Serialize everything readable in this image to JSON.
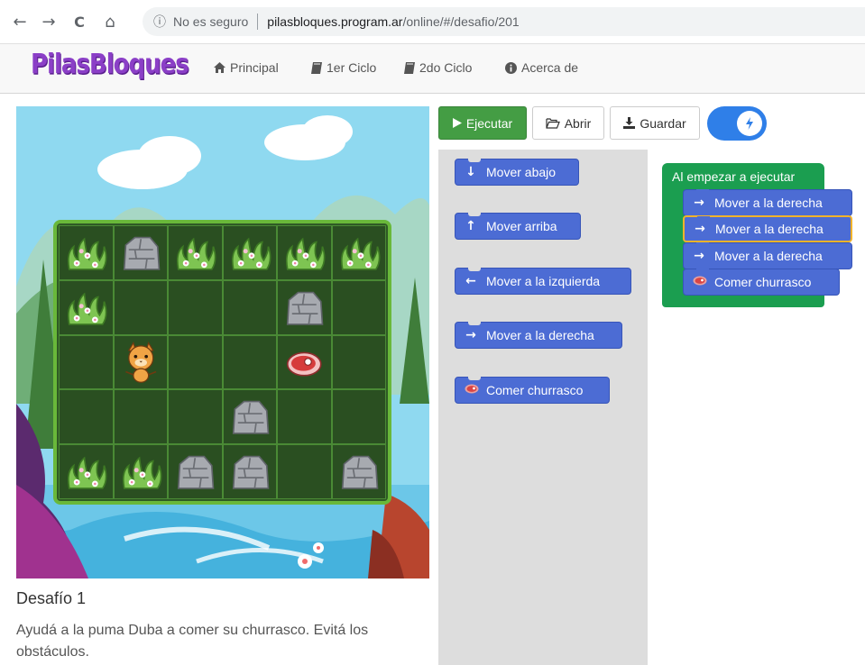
{
  "browser": {
    "back": "←",
    "forward": "→",
    "reload": "C",
    "home": "⌂",
    "info_icon": "ⓘ",
    "insecure": "No es seguro",
    "host": "pilasbloques.program.ar",
    "path": "/online/#/desafio/201"
  },
  "app": {
    "logo": "PilasBloques",
    "nav": [
      {
        "icon": "home-icon",
        "label": "Principal"
      },
      {
        "icon": "book-icon",
        "label": "1er Ciclo"
      },
      {
        "icon": "book-icon",
        "label": "2do Ciclo"
      },
      {
        "icon": "info-icon",
        "label": "Acerca de"
      }
    ]
  },
  "toolbar": {
    "run": "Ejecutar",
    "open": "Abrir",
    "save": "Guardar",
    "turbo_icon": "lightning-icon",
    "turbo_on": true
  },
  "challenge": {
    "title": "Desafío 1",
    "description": "Ayudá a la puma Duba a comer su churrasco. Evitá los obstáculos."
  },
  "toolbox": [
    {
      "icon": "arrow-down-icon",
      "label": "Mover abajo"
    },
    {
      "icon": "arrow-up-icon",
      "label": "Mover arriba"
    },
    {
      "icon": "arrow-left-icon",
      "label": "Mover a la izquierda"
    },
    {
      "icon": "arrow-right-icon",
      "label": "Mover a la derecha"
    },
    {
      "icon": "steak-icon",
      "label": "Comer churrasco"
    }
  ],
  "program": {
    "hat": "Al empezar a ejecutar",
    "blocks": [
      {
        "icon": "arrow-right-icon",
        "label": "Mover a la derecha",
        "selected": false
      },
      {
        "icon": "arrow-right-icon",
        "label": "Mover a la derecha",
        "selected": true
      },
      {
        "icon": "arrow-right-icon",
        "label": "Mover a la derecha",
        "selected": false
      },
      {
        "icon": "steak-icon",
        "label": "Comer churrasco",
        "selected": false
      }
    ]
  },
  "grid": {
    "rows": 5,
    "cols": 6,
    "cells": [
      [
        "bush",
        "rock",
        "bush",
        "bush",
        "bush",
        "bush"
      ],
      [
        "bush",
        "",
        "",
        "",
        "rock",
        ""
      ],
      [
        "",
        "puma",
        "",
        "",
        "steak",
        ""
      ],
      [
        "",
        "",
        "",
        "rock",
        "",
        ""
      ],
      [
        "bush",
        "bush",
        "rock",
        "rock",
        "",
        "rock"
      ]
    ]
  },
  "colors": {
    "block": "#4c6cd4",
    "hat": "#1b9e50",
    "run_button": "#449d44",
    "toggle": "#2f7fe8",
    "logo": "#8b3fc7",
    "selected_outline": "#f2b32a"
  }
}
